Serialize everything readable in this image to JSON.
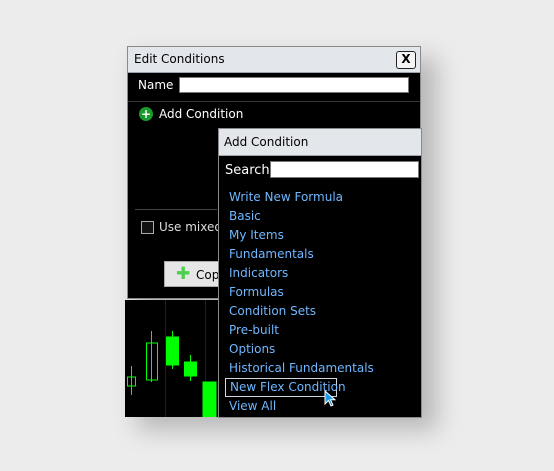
{
  "edit_window": {
    "title": "Edit Conditions",
    "close_label": "X",
    "name_label": "Name",
    "name_value": "",
    "add_condition_label": "Add Condition",
    "use_mixed_label": "Use mixed",
    "copy_label": "Cop"
  },
  "add_window": {
    "title": "Add Condition",
    "search_label": "Search",
    "search_value": "",
    "items": [
      "Write New Formula",
      "Basic",
      "My Items",
      "Fundamentals",
      "Indicators",
      "Formulas",
      "Condition Sets",
      "Pre-built",
      "Options",
      "Historical Fundamentals",
      "New Flex Condition",
      "View All"
    ],
    "selected_item": "New Flex Condition"
  },
  "colors": {
    "link": "#6fb7ff",
    "accent_green": "#1a9a2a",
    "candle_green": "#00ff00"
  }
}
